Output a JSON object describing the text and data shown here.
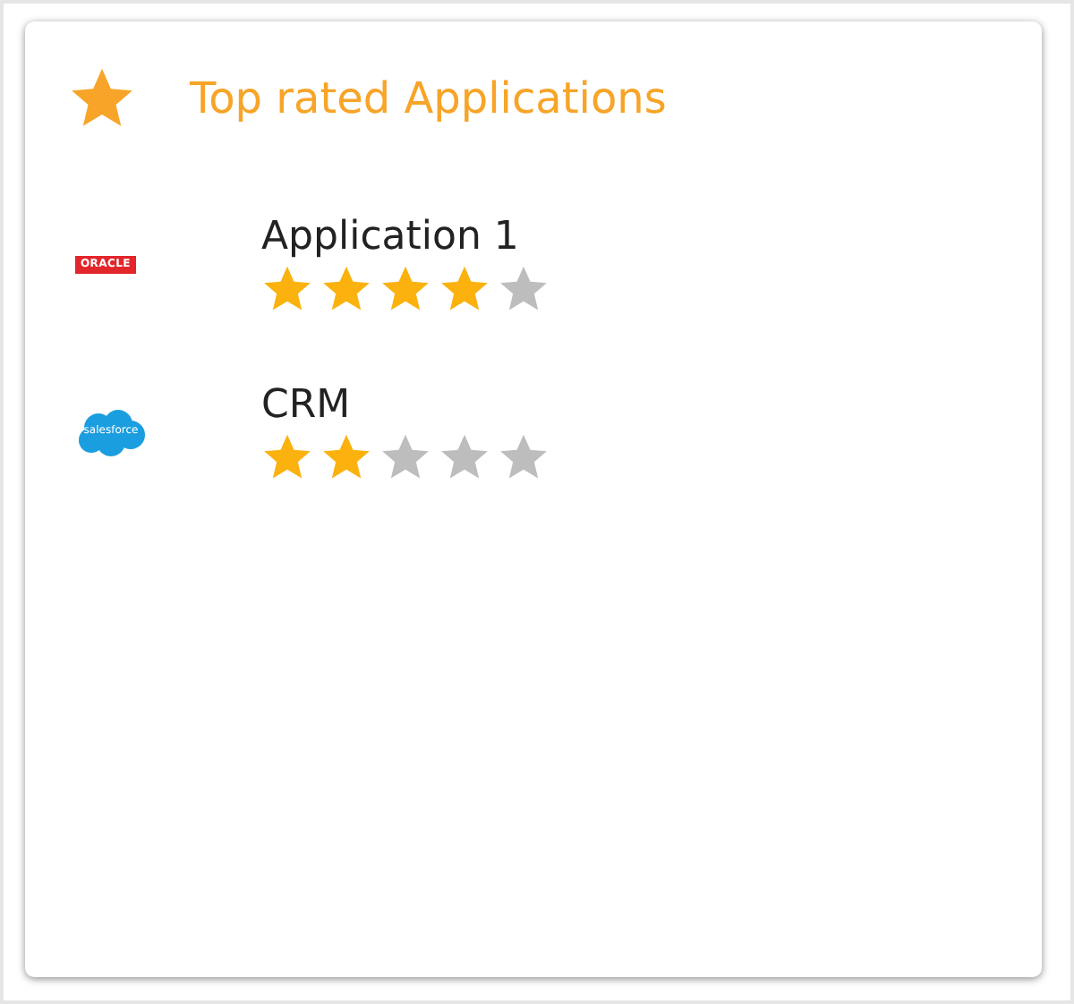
{
  "card": {
    "title": "Top rated Applications"
  },
  "applications": [
    {
      "name": "Application 1",
      "stars": 4,
      "logo": {
        "kind": "oracle",
        "text": "ORACLE"
      }
    },
    {
      "name": "CRM",
      "stars": 2,
      "logo": {
        "kind": "salesforce",
        "text": "salesforce"
      }
    }
  ]
}
